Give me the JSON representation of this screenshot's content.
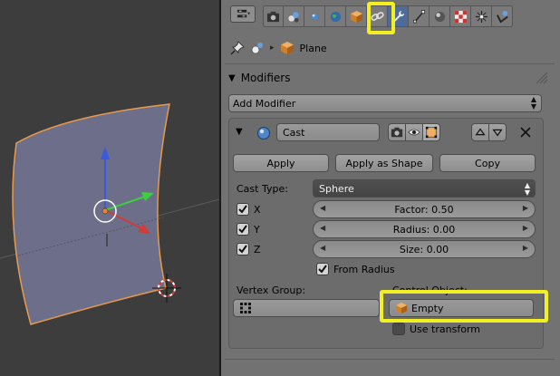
{
  "header": {
    "editor_menu_icon": "editor-type-icon",
    "tabs": [
      {
        "id": "render",
        "icon": "camera-icon"
      },
      {
        "id": "render-layers",
        "icon": "layers-icon"
      },
      {
        "id": "scene",
        "icon": "scene-icon"
      },
      {
        "id": "world",
        "icon": "world-icon"
      },
      {
        "id": "object",
        "icon": "cube-icon"
      },
      {
        "id": "constraints",
        "icon": "chain-icon"
      },
      {
        "id": "modifiers",
        "icon": "wrench-icon",
        "active": true
      },
      {
        "id": "data",
        "icon": "vertex-data-icon"
      },
      {
        "id": "material",
        "icon": "material-icon"
      },
      {
        "id": "texture",
        "icon": "texture-icon"
      },
      {
        "id": "particles",
        "icon": "particles-icon"
      },
      {
        "id": "physics",
        "icon": "physics-icon"
      }
    ]
  },
  "breadcrumb": {
    "object_name": "Plane"
  },
  "modifiers": {
    "section_title": "Modifiers",
    "add_modifier_label": "Add Modifier",
    "cast": {
      "name": "Cast",
      "apply_label": "Apply",
      "apply_as_shape_label": "Apply as Shape",
      "copy_label": "Copy",
      "cast_type_label": "Cast Type:",
      "cast_type_value": "Sphere",
      "axis_x_label": "X",
      "axis_y_label": "Y",
      "axis_z_label": "Z",
      "axis_x": true,
      "axis_y": true,
      "axis_z": true,
      "factor_text": "Factor: 0.50",
      "radius_text": "Radius: 0.00",
      "size_text": "Size: 0.00",
      "from_radius_label": "From Radius",
      "from_radius": true,
      "vertex_group_label": "Vertex Group:",
      "vertex_group_value": "",
      "control_object_label": "Control Object:",
      "control_object_value": "Empty",
      "use_transform_label": "Use transform",
      "use_transform": false
    }
  },
  "colors": {
    "highlight": "#f2f023",
    "active_tab": "#4f6b9b",
    "mesh_face": "#6c6e8a",
    "mesh_outline": "#e89a4c",
    "axis_x": "#d33a3a",
    "axis_y": "#3ad23a",
    "axis_z": "#3a5ae0"
  }
}
